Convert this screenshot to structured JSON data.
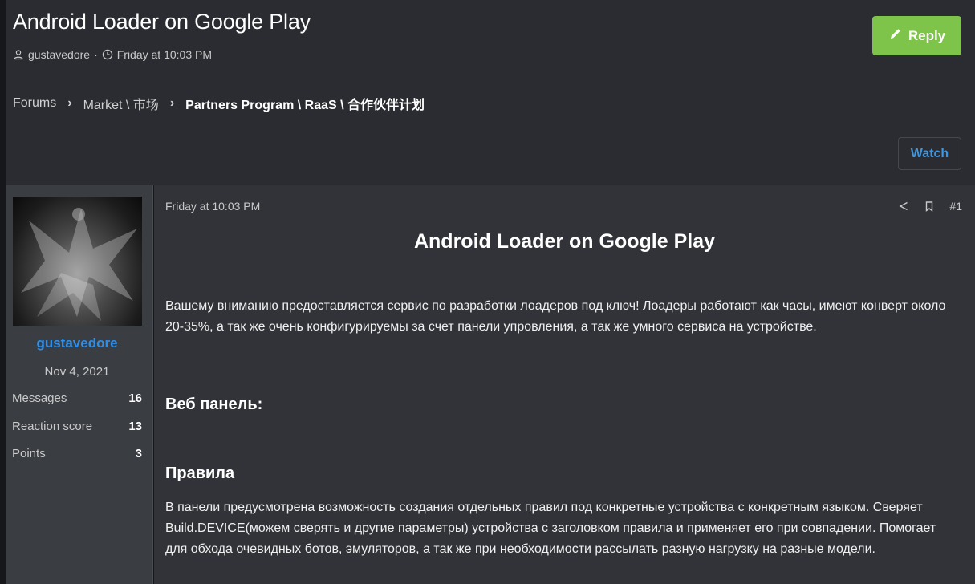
{
  "thread": {
    "title": "Android Loader on Google Play",
    "author": "gustavedore",
    "meta_separator": "·",
    "posted": "Friday at 10:03 PM"
  },
  "reply_button": {
    "label": "Reply",
    "color": "#7ec34a",
    "icon": "pencil-icon"
  },
  "breadcrumb": {
    "items": [
      "Forums",
      "Market \\ 市场",
      "Partners Program \\ RaaS \\ 合作伙伴计划"
    ],
    "separator": "›"
  },
  "watch_button": {
    "label": "Watch",
    "color": "#3e96e0"
  },
  "user": {
    "name": "gustavedore",
    "joined": "Nov 4, 2021",
    "stats": [
      {
        "label": "Messages",
        "value": "16"
      },
      {
        "label": "Reaction score",
        "value": "13"
      },
      {
        "label": "Points",
        "value": "3"
      }
    ]
  },
  "post": {
    "date": "Friday at 10:03 PM",
    "number": "#1",
    "action_icons": [
      "share-icon",
      "bookmark-icon"
    ],
    "title": "Android Loader on Google Play",
    "intro": "Вашему вниманию предоставляется сервис по разработки лоадеров под ключ! Лоадеры работают как часы, имеют конверт около 20-35%, а так же очень конфигурируемы за счет панели упровления, а так же умного сервиса на устройстве.",
    "heading_web": "Веб панель:",
    "heading_rules": "Правила",
    "rules_text": "В панели предусмотрена возможность создания отдельных правил под конкретные устройства с конкретным языком. Сверяет Build.DEVICE(можем сверять и другие параметры) устройства с заголовком правила и применяет его при совпадении. Помогает для обхода очевидных ботов, эмуляторов, а так же при необходимости рассылать разную нагрузку на разные модели."
  }
}
